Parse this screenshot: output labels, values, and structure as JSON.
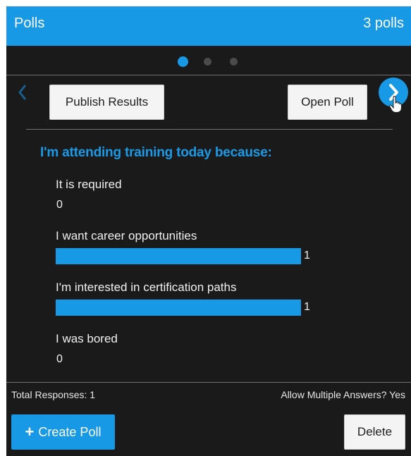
{
  "header": {
    "title": "Polls",
    "poll_count": "3 polls"
  },
  "pager": {
    "total_pages": 3,
    "active_index": 0
  },
  "toolbar": {
    "publish_label": "Publish Results",
    "open_label": "Open Poll"
  },
  "poll": {
    "question": "I'm attending training today because:",
    "answers": [
      {
        "label": "It is required",
        "count": "0",
        "fraction": 0
      },
      {
        "label": "I want career opportunities",
        "count": "1",
        "fraction": 1
      },
      {
        "label": "I'm interested in certification paths",
        "count": "1",
        "fraction": 1
      },
      {
        "label": "I was bored",
        "count": "0",
        "fraction": 0
      }
    ]
  },
  "footer": {
    "total_responses": "Total Responses: 1",
    "allow_multiple": "Allow Multiple Answers? Yes",
    "create_label": "Create Poll",
    "delete_label": "Delete"
  },
  "colors": {
    "accent": "#1799e6",
    "background": "#1a1a1a"
  },
  "icons": {
    "prev": "chevron-left-icon",
    "next": "chevron-right-icon",
    "create": "plus-icon",
    "cursor": "hand-cursor-icon"
  }
}
